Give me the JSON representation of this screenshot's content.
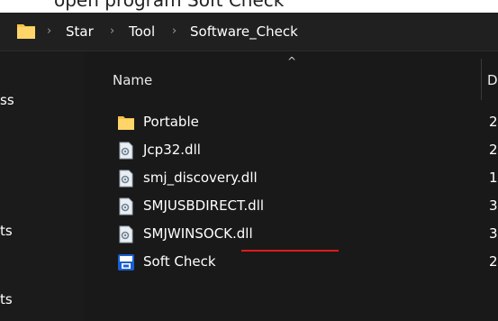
{
  "top_strip": {
    "cut_text": "open program Soft Check"
  },
  "breadcrumb": {
    "items": [
      "Star",
      "Tool",
      "Software_Check"
    ],
    "icon": "folder-icon",
    "separator_icon": "chevron-right-icon"
  },
  "sidebar": {
    "items": [
      {
        "label": "ss"
      },
      {
        "label": "ts"
      },
      {
        "label": "ts"
      }
    ]
  },
  "file_list": {
    "columns": {
      "name": "Name",
      "date_cut": "D"
    },
    "rows": [
      {
        "name": "Portable",
        "icon": "folder-icon",
        "date_cut": "2"
      },
      {
        "name": "Jcp32.dll",
        "icon": "dll-file-icon",
        "date_cut": "2"
      },
      {
        "name": "smj_discovery.dll",
        "icon": "dll-file-icon",
        "date_cut": "1"
      },
      {
        "name": "SMJUSBDIRECT.dll",
        "icon": "dll-file-icon",
        "date_cut": "3"
      },
      {
        "name": "SMJWINSOCK.dll",
        "icon": "dll-file-icon",
        "date_cut": "3"
      },
      {
        "name": "Soft Check",
        "icon": "app-icon",
        "date_cut": "2"
      }
    ]
  },
  "colors": {
    "background": "#191919",
    "folder": "#f5c242",
    "annotation_underline": "#e01a1a"
  }
}
